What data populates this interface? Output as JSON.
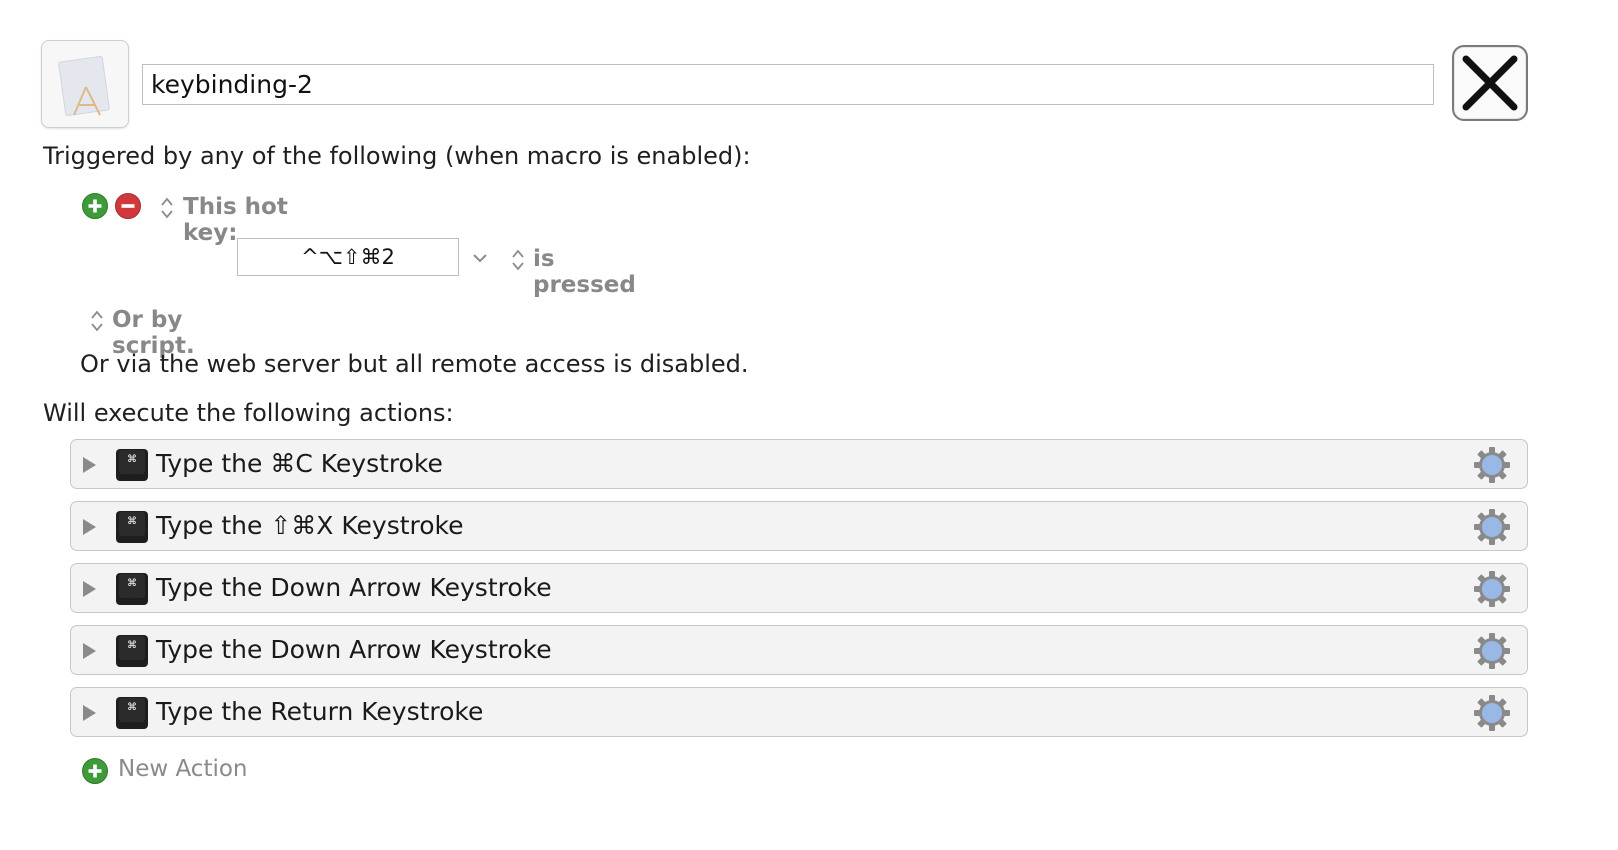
{
  "macro": {
    "name": "keybinding-2"
  },
  "triggers": {
    "heading": "Triggered by any of the following (when macro is enabled):",
    "hot_key_label": "This hot key:",
    "hot_key_value": "^⌥⇧⌘2",
    "pressed_label": "is pressed",
    "script_label": "Or by script.",
    "web_server_note": "Or via the web server but all remote access is disabled."
  },
  "actions": {
    "heading": "Will execute the following actions:",
    "items": [
      {
        "label": "Type the ⌘C Keystroke"
      },
      {
        "label": "Type the ⇧⌘X Keystroke"
      },
      {
        "label": "Type the Down Arrow Keystroke"
      },
      {
        "label": "Type the Down Arrow Keystroke"
      },
      {
        "label": "Type the Return Keystroke"
      }
    ],
    "new_action_label": "New Action"
  },
  "icons": {
    "macro": "macro-app-icon",
    "close": "close-icon",
    "add": "plus-circle-icon",
    "remove": "minus-circle-icon",
    "disclosure": "disclosure-triangle-icon",
    "keystroke": "keycap-icon",
    "gear": "gear-icon"
  },
  "colors": {
    "add_green": "#3f9b3a",
    "remove_red": "#d0383d",
    "gear_blue": "#9ab8e6"
  }
}
